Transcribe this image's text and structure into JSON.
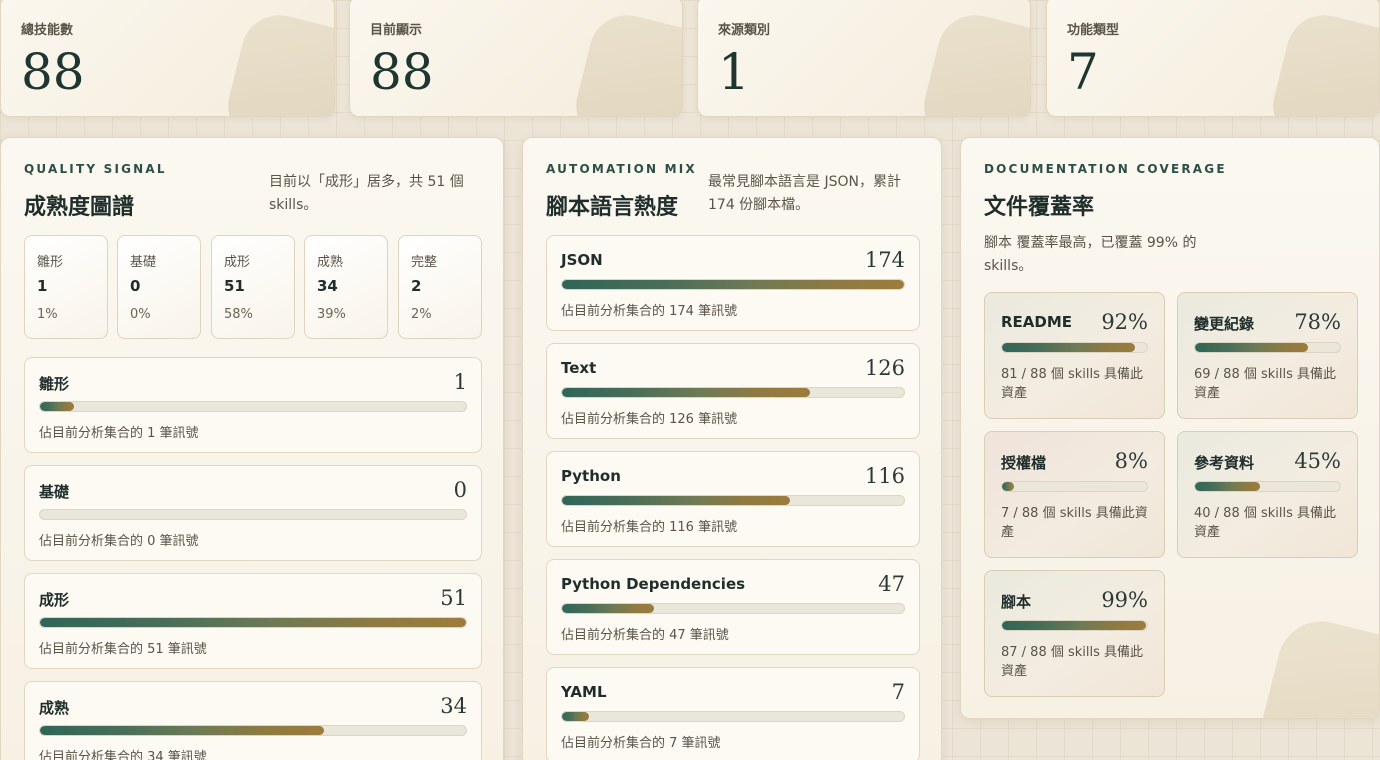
{
  "stats": [
    {
      "label": "總技能數",
      "value": "88"
    },
    {
      "label": "目前顯示",
      "value": "88"
    },
    {
      "label": "來源類別",
      "value": "1"
    },
    {
      "label": "功能類型",
      "value": "7"
    }
  ],
  "quality": {
    "eyebrow": "QUALITY SIGNAL",
    "title": "成熟度圖譜",
    "desc": "目前以「成形」居多，共 51 個 skills。",
    "levels": [
      {
        "name": "雛形",
        "count": "1",
        "pct": "1%"
      },
      {
        "name": "基礎",
        "count": "0",
        "pct": "0%"
      },
      {
        "name": "成形",
        "count": "51",
        "pct": "58%"
      },
      {
        "name": "成熟",
        "count": "34",
        "pct": "39%"
      },
      {
        "name": "完整",
        "count": "2",
        "pct": "2%"
      }
    ],
    "bars": [
      {
        "name": "雛形",
        "value": "1",
        "note": "佔目前分析集合的 1 筆訊號",
        "fill": 0.08
      },
      {
        "name": "基礎",
        "value": "0",
        "note": "佔目前分析集合的 0 筆訊號",
        "fill": 0
      },
      {
        "name": "成形",
        "value": "51",
        "note": "佔目前分析集合的 51 筆訊號",
        "fill": 1.0
      },
      {
        "name": "成熟",
        "value": "34",
        "note": "佔目前分析集合的 34 筆訊號",
        "fill": 0.667
      }
    ]
  },
  "automation": {
    "eyebrow": "AUTOMATION MIX",
    "title": "腳本語言熱度",
    "desc": "最常見腳本語言是 JSON，累計 174 份腳本檔。",
    "bars": [
      {
        "name": "JSON",
        "value": "174",
        "note": "佔目前分析集合的 174 筆訊號",
        "fill": 1.0
      },
      {
        "name": "Text",
        "value": "126",
        "note": "佔目前分析集合的 126 筆訊號",
        "fill": 0.724
      },
      {
        "name": "Python",
        "value": "116",
        "note": "佔目前分析集合的 116 筆訊號",
        "fill": 0.667
      },
      {
        "name": "Python Dependencies",
        "value": "47",
        "note": "佔目前分析集合的 47 筆訊號",
        "fill": 0.27
      },
      {
        "name": "YAML",
        "value": "7",
        "note": "佔目前分析集合的 7 筆訊號",
        "fill": 0.08
      }
    ]
  },
  "documentation": {
    "eyebrow": "DOCUMENTATION COVERAGE",
    "title": "文件覆蓋率",
    "desc": "腳本 覆蓋率最高，已覆蓋 99% 的 skills。",
    "items": [
      {
        "name": "README",
        "pct": "92%",
        "note": "81 / 88 個 skills 具備此資產",
        "fill": 0.92
      },
      {
        "name": "變更紀錄",
        "pct": "78%",
        "note": "69 / 88 個 skills 具備此資產",
        "fill": 0.78
      },
      {
        "name": "授權檔",
        "pct": "8%",
        "note": "7 / 88 個 skills 具備此資產",
        "fill": 0.08
      },
      {
        "name": "參考資料",
        "pct": "45%",
        "note": "40 / 88 個 skills 具備此資產",
        "fill": 0.45
      },
      {
        "name": "腳本",
        "pct": "99%",
        "note": "87 / 88 個 skills 具備此資產",
        "fill": 0.99
      }
    ]
  }
}
